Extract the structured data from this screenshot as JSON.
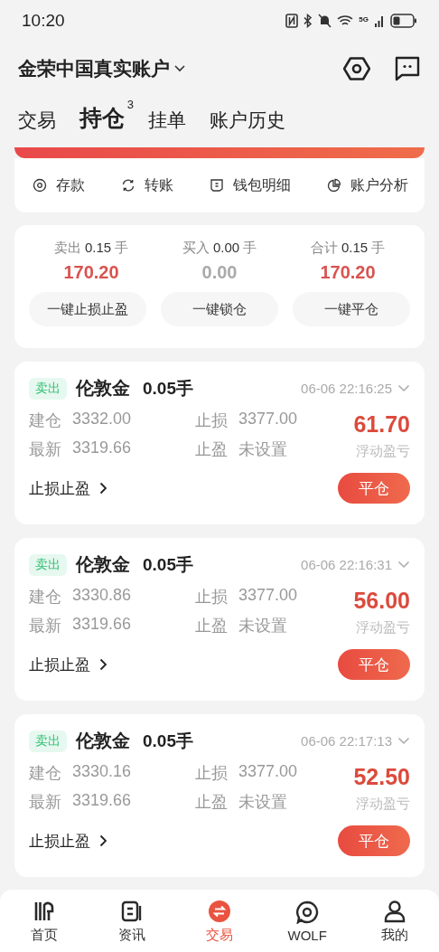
{
  "status_bar": {
    "time": "10:20",
    "network": "5G"
  },
  "header": {
    "account": "金荣中国真实账户"
  },
  "tabs": [
    {
      "label": "交易",
      "selected": false
    },
    {
      "label": "持仓",
      "selected": true,
      "badge": "3"
    },
    {
      "label": "挂单",
      "selected": false
    },
    {
      "label": "账户历史",
      "selected": false
    }
  ],
  "actions": [
    {
      "label": "存款",
      "kind": "deposit"
    },
    {
      "label": "转账",
      "kind": "transfer"
    },
    {
      "label": "钱包明细",
      "kind": "wallet"
    },
    {
      "label": "账户分析",
      "kind": "analysis"
    }
  ],
  "summary": {
    "columns": [
      {
        "label": "卖出",
        "lots": "0.15",
        "unit": "手",
        "value": "170.20",
        "kind": "gain"
      },
      {
        "label": "买入",
        "lots": "0.00",
        "unit": "手",
        "value": "0.00",
        "kind": "flat"
      },
      {
        "label": "合计",
        "lots": "0.15",
        "unit": "手",
        "value": "170.20",
        "kind": "gain"
      }
    ],
    "buttons": [
      "一键止损止盈",
      "一键锁仓",
      "一键平仓"
    ]
  },
  "positions": [
    {
      "side": "卖出",
      "symbol": "伦敦金",
      "lots": "0.05手",
      "time": "06-06 22:16:25",
      "fields": [
        {
          "label": "建仓",
          "value": "3332.00"
        },
        {
          "label": "止损",
          "value": "3377.00"
        },
        {
          "label": "最新",
          "value": "3319.66"
        },
        {
          "label": "止盈",
          "value": "未设置"
        }
      ],
      "pnl": "61.70",
      "pnl_label": "浮动盈亏",
      "link": "止损止盈",
      "close": "平仓"
    },
    {
      "side": "卖出",
      "symbol": "伦敦金",
      "lots": "0.05手",
      "time": "06-06 22:16:31",
      "fields": [
        {
          "label": "建仓",
          "value": "3330.86"
        },
        {
          "label": "止损",
          "value": "3377.00"
        },
        {
          "label": "最新",
          "value": "3319.66"
        },
        {
          "label": "止盈",
          "value": "未设置"
        }
      ],
      "pnl": "56.00",
      "pnl_label": "浮动盈亏",
      "link": "止损止盈",
      "close": "平仓"
    },
    {
      "side": "卖出",
      "symbol": "伦敦金",
      "lots": "0.05手",
      "time": "06-06 22:17:13",
      "fields": [
        {
          "label": "建仓",
          "value": "3330.16"
        },
        {
          "label": "止损",
          "value": "3377.00"
        },
        {
          "label": "最新",
          "value": "3319.66"
        },
        {
          "label": "止盈",
          "value": "未设置"
        }
      ],
      "pnl": "52.50",
      "pnl_label": "浮动盈亏",
      "link": "止损止盈",
      "close": "平仓"
    }
  ],
  "bottom_nav": [
    {
      "label": "首页",
      "kind": "home",
      "selected": false
    },
    {
      "label": "资讯",
      "kind": "news",
      "selected": false
    },
    {
      "label": "交易",
      "kind": "trade",
      "selected": true
    },
    {
      "label": "WOLF",
      "kind": "chat",
      "selected": false
    },
    {
      "label": "我的",
      "kind": "profile",
      "selected": false
    }
  ]
}
